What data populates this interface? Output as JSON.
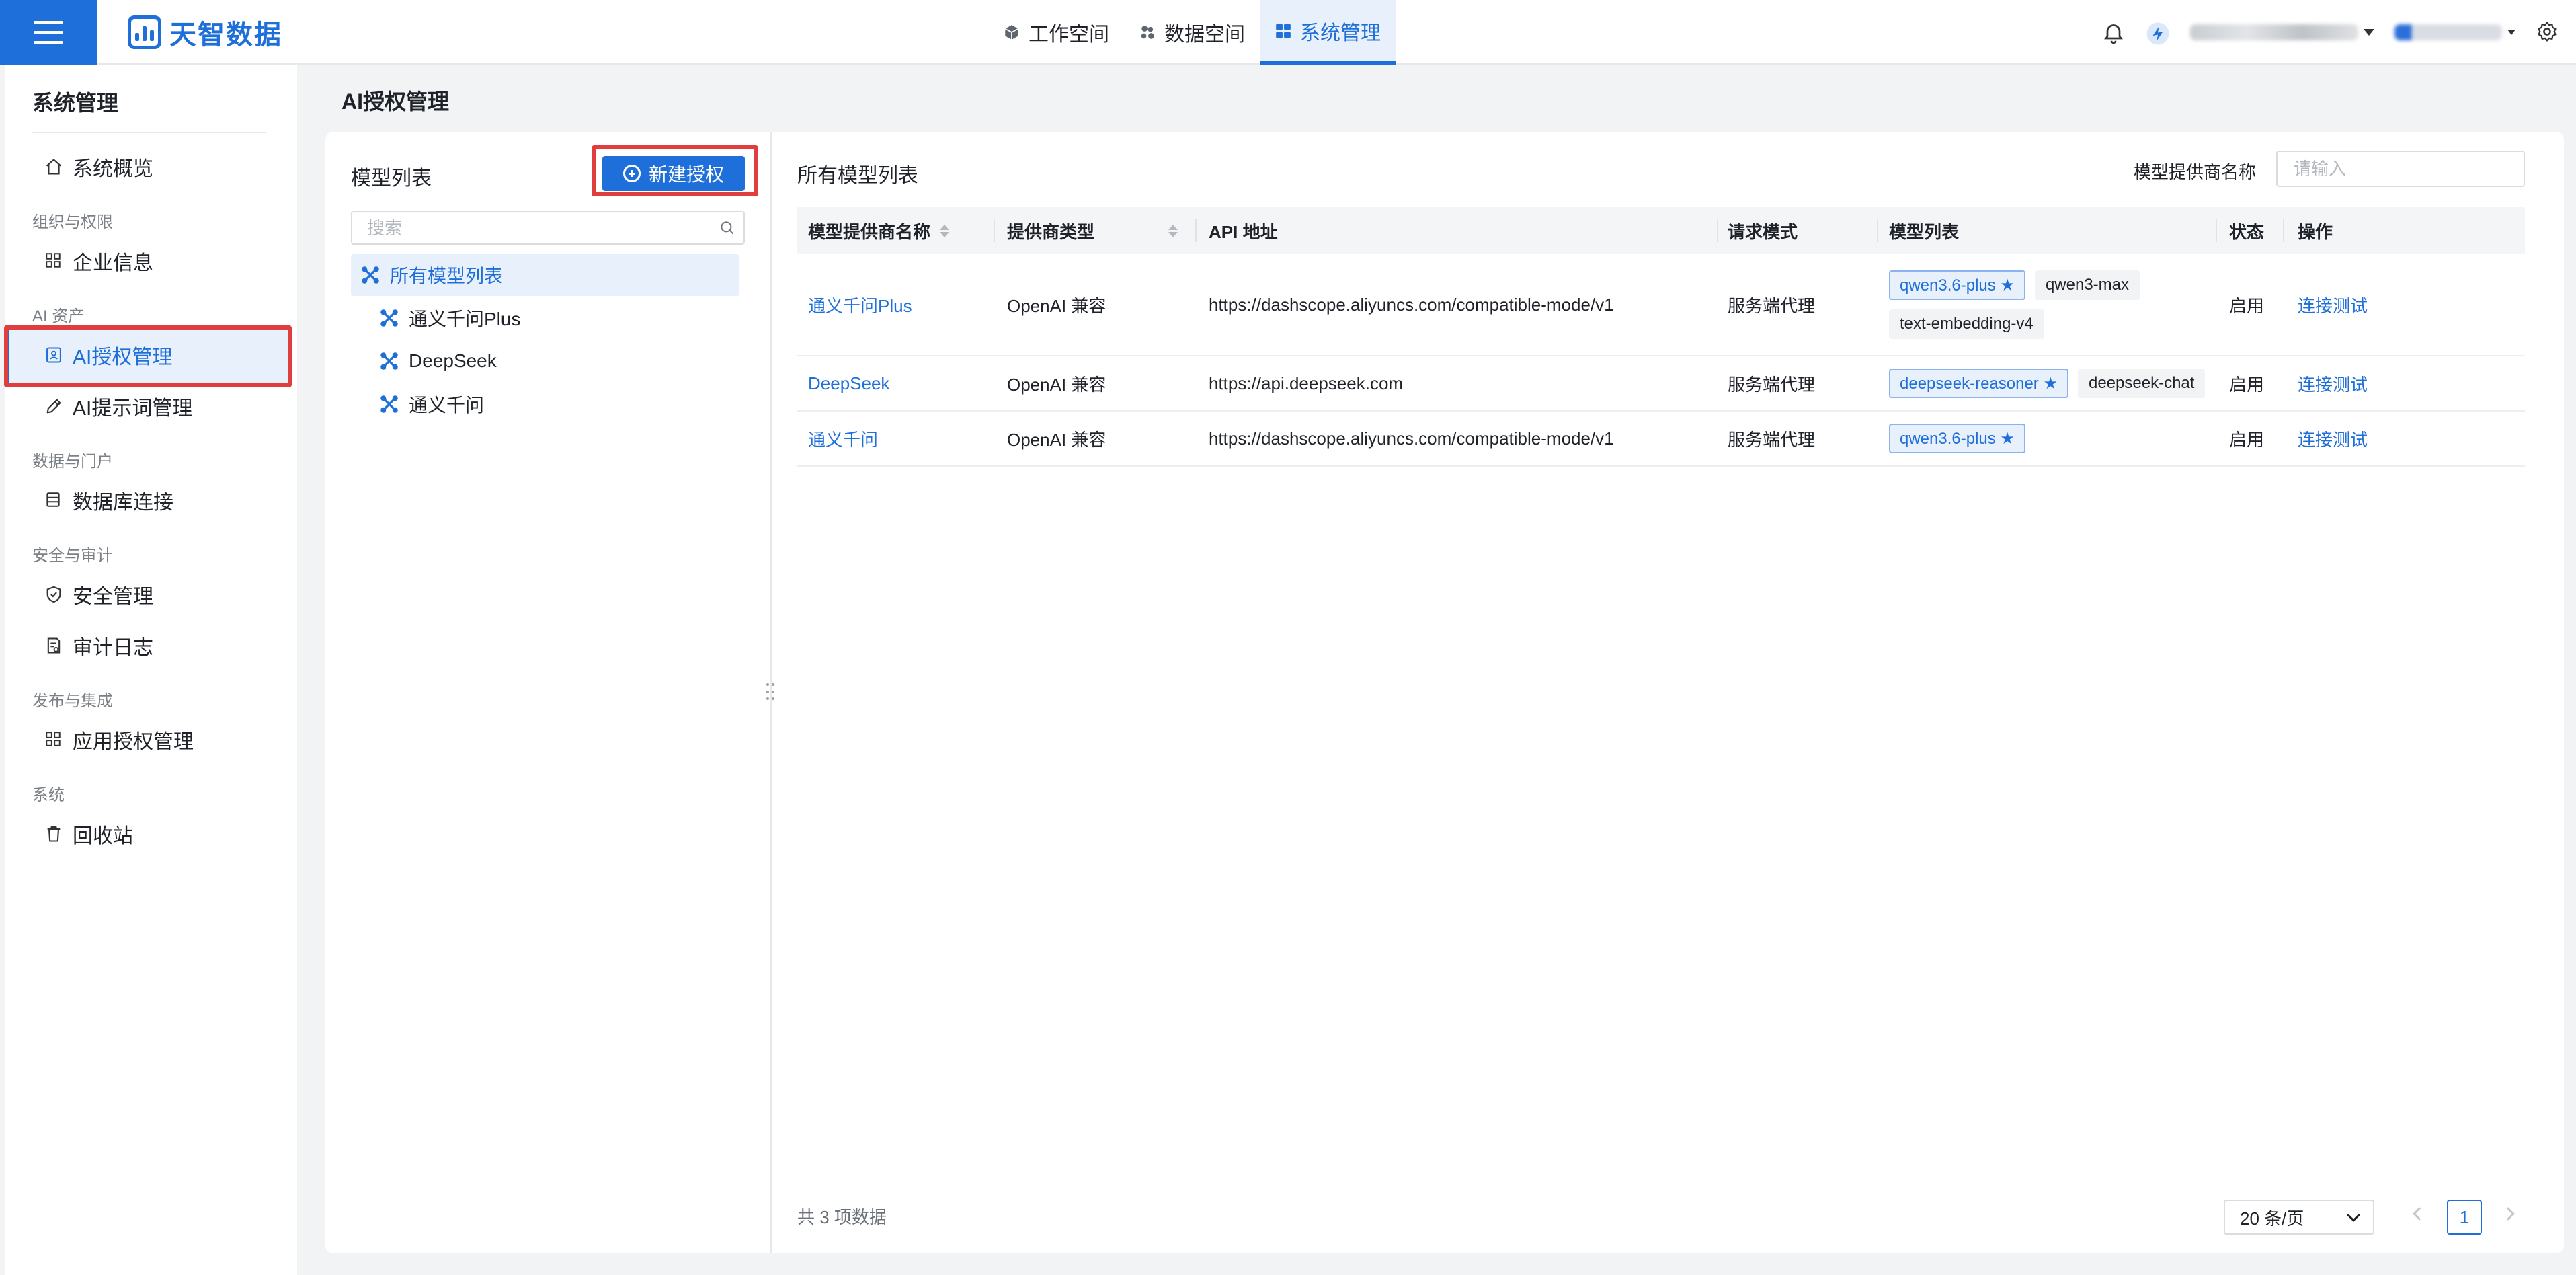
{
  "brand": {
    "name": "天智数据"
  },
  "topnav": [
    {
      "label": "工作空间",
      "icon": "cube-icon"
    },
    {
      "label": "数据空间",
      "icon": "molecule-icon"
    },
    {
      "label": "系统管理",
      "icon": "grid-icon",
      "active": true
    }
  ],
  "sidebar": {
    "title": "系统管理",
    "overview": "系统概览",
    "groups": [
      {
        "label": "组织与权限",
        "items": [
          {
            "label": "企业信息",
            "icon": "grid-icon"
          }
        ]
      },
      {
        "label": "AI 资产",
        "items": [
          {
            "label": "AI授权管理",
            "icon": "id-card-icon",
            "active": true
          },
          {
            "label": "AI提示词管理",
            "icon": "pen-icon"
          }
        ]
      },
      {
        "label": "数据与门户",
        "items": [
          {
            "label": "数据库连接",
            "icon": "database-icon"
          }
        ]
      },
      {
        "label": "安全与审计",
        "items": [
          {
            "label": "安全管理",
            "icon": "shield-icon"
          },
          {
            "label": "审计日志",
            "icon": "log-icon"
          }
        ]
      },
      {
        "label": "发布与集成",
        "items": [
          {
            "label": "应用授权管理",
            "icon": "grid-icon"
          }
        ]
      },
      {
        "label": "系统",
        "items": [
          {
            "label": "回收站",
            "icon": "trash-icon"
          }
        ]
      }
    ]
  },
  "page": {
    "title": "AI授权管理"
  },
  "left_panel": {
    "title": "模型列表",
    "new_button": "新建授权",
    "search_placeholder": "搜索",
    "tree": {
      "root": "所有模型列表",
      "children": [
        "通义千问Plus",
        "DeepSeek",
        "通义千问"
      ]
    }
  },
  "right_panel": {
    "title": "所有模型列表",
    "filter_label": "模型提供商名称",
    "filter_placeholder": "请输入",
    "columns": [
      "模型提供商名称",
      "提供商类型",
      "API 地址",
      "请求模式",
      "模型列表",
      "状态",
      "操作"
    ],
    "rows": [
      {
        "provider": "通义千问Plus",
        "type": "OpenAI 兼容",
        "api": "https://dashscope.aliyuncs.com/compatible-mode/v1",
        "mode": "服务端代理",
        "models": [
          {
            "name": "qwen3.6-plus ★",
            "default": true
          },
          {
            "name": "qwen3-max"
          },
          {
            "name": "text-embedding-v4"
          }
        ],
        "status": "启用",
        "action": "连接测试"
      },
      {
        "provider": "DeepSeek",
        "type": "OpenAI 兼容",
        "api": "https://api.deepseek.com",
        "mode": "服务端代理",
        "models": [
          {
            "name": "deepseek-reasoner ★",
            "default": true
          },
          {
            "name": "deepseek-chat"
          }
        ],
        "status": "启用",
        "action": "连接测试"
      },
      {
        "provider": "通义千问",
        "type": "OpenAI 兼容",
        "api": "https://dashscope.aliyuncs.com/compatible-mode/v1",
        "mode": "服务端代理",
        "models": [
          {
            "name": "qwen3.6-plus ★",
            "default": true
          }
        ],
        "status": "启用",
        "action": "连接测试"
      }
    ],
    "footer": {
      "total": "共 3 项数据",
      "page_size": "20 条/页",
      "current_page": "1"
    }
  },
  "colors": {
    "primary": "#1e6fd9",
    "highlight": "#e03e3e",
    "background": "#f2f3f5"
  }
}
